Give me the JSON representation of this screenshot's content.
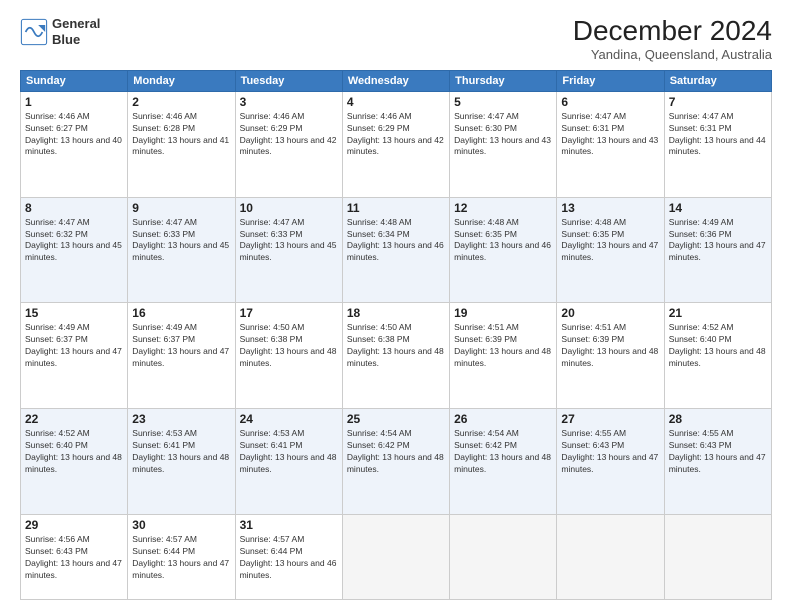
{
  "header": {
    "logo_line1": "General",
    "logo_line2": "Blue",
    "month": "December 2024",
    "location": "Yandina, Queensland, Australia"
  },
  "weekdays": [
    "Sunday",
    "Monday",
    "Tuesday",
    "Wednesday",
    "Thursday",
    "Friday",
    "Saturday"
  ],
  "weeks": [
    [
      {
        "day": "1",
        "info": "Sunrise: 4:46 AM\nSunset: 6:27 PM\nDaylight: 13 hours and 40 minutes."
      },
      {
        "day": "2",
        "info": "Sunrise: 4:46 AM\nSunset: 6:28 PM\nDaylight: 13 hours and 41 minutes."
      },
      {
        "day": "3",
        "info": "Sunrise: 4:46 AM\nSunset: 6:29 PM\nDaylight: 13 hours and 42 minutes."
      },
      {
        "day": "4",
        "info": "Sunrise: 4:46 AM\nSunset: 6:29 PM\nDaylight: 13 hours and 42 minutes."
      },
      {
        "day": "5",
        "info": "Sunrise: 4:47 AM\nSunset: 6:30 PM\nDaylight: 13 hours and 43 minutes."
      },
      {
        "day": "6",
        "info": "Sunrise: 4:47 AM\nSunset: 6:31 PM\nDaylight: 13 hours and 43 minutes."
      },
      {
        "day": "7",
        "info": "Sunrise: 4:47 AM\nSunset: 6:31 PM\nDaylight: 13 hours and 44 minutes."
      }
    ],
    [
      {
        "day": "8",
        "info": "Sunrise: 4:47 AM\nSunset: 6:32 PM\nDaylight: 13 hours and 45 minutes."
      },
      {
        "day": "9",
        "info": "Sunrise: 4:47 AM\nSunset: 6:33 PM\nDaylight: 13 hours and 45 minutes."
      },
      {
        "day": "10",
        "info": "Sunrise: 4:47 AM\nSunset: 6:33 PM\nDaylight: 13 hours and 45 minutes."
      },
      {
        "day": "11",
        "info": "Sunrise: 4:48 AM\nSunset: 6:34 PM\nDaylight: 13 hours and 46 minutes."
      },
      {
        "day": "12",
        "info": "Sunrise: 4:48 AM\nSunset: 6:35 PM\nDaylight: 13 hours and 46 minutes."
      },
      {
        "day": "13",
        "info": "Sunrise: 4:48 AM\nSunset: 6:35 PM\nDaylight: 13 hours and 47 minutes."
      },
      {
        "day": "14",
        "info": "Sunrise: 4:49 AM\nSunset: 6:36 PM\nDaylight: 13 hours and 47 minutes."
      }
    ],
    [
      {
        "day": "15",
        "info": "Sunrise: 4:49 AM\nSunset: 6:37 PM\nDaylight: 13 hours and 47 minutes."
      },
      {
        "day": "16",
        "info": "Sunrise: 4:49 AM\nSunset: 6:37 PM\nDaylight: 13 hours and 47 minutes."
      },
      {
        "day": "17",
        "info": "Sunrise: 4:50 AM\nSunset: 6:38 PM\nDaylight: 13 hours and 48 minutes."
      },
      {
        "day": "18",
        "info": "Sunrise: 4:50 AM\nSunset: 6:38 PM\nDaylight: 13 hours and 48 minutes."
      },
      {
        "day": "19",
        "info": "Sunrise: 4:51 AM\nSunset: 6:39 PM\nDaylight: 13 hours and 48 minutes."
      },
      {
        "day": "20",
        "info": "Sunrise: 4:51 AM\nSunset: 6:39 PM\nDaylight: 13 hours and 48 minutes."
      },
      {
        "day": "21",
        "info": "Sunrise: 4:52 AM\nSunset: 6:40 PM\nDaylight: 13 hours and 48 minutes."
      }
    ],
    [
      {
        "day": "22",
        "info": "Sunrise: 4:52 AM\nSunset: 6:40 PM\nDaylight: 13 hours and 48 minutes."
      },
      {
        "day": "23",
        "info": "Sunrise: 4:53 AM\nSunset: 6:41 PM\nDaylight: 13 hours and 48 minutes."
      },
      {
        "day": "24",
        "info": "Sunrise: 4:53 AM\nSunset: 6:41 PM\nDaylight: 13 hours and 48 minutes."
      },
      {
        "day": "25",
        "info": "Sunrise: 4:54 AM\nSunset: 6:42 PM\nDaylight: 13 hours and 48 minutes."
      },
      {
        "day": "26",
        "info": "Sunrise: 4:54 AM\nSunset: 6:42 PM\nDaylight: 13 hours and 48 minutes."
      },
      {
        "day": "27",
        "info": "Sunrise: 4:55 AM\nSunset: 6:43 PM\nDaylight: 13 hours and 47 minutes."
      },
      {
        "day": "28",
        "info": "Sunrise: 4:55 AM\nSunset: 6:43 PM\nDaylight: 13 hours and 47 minutes."
      }
    ],
    [
      {
        "day": "29",
        "info": "Sunrise: 4:56 AM\nSunset: 6:43 PM\nDaylight: 13 hours and 47 minutes."
      },
      {
        "day": "30",
        "info": "Sunrise: 4:57 AM\nSunset: 6:44 PM\nDaylight: 13 hours and 47 minutes."
      },
      {
        "day": "31",
        "info": "Sunrise: 4:57 AM\nSunset: 6:44 PM\nDaylight: 13 hours and 46 minutes."
      },
      null,
      null,
      null,
      null
    ]
  ]
}
